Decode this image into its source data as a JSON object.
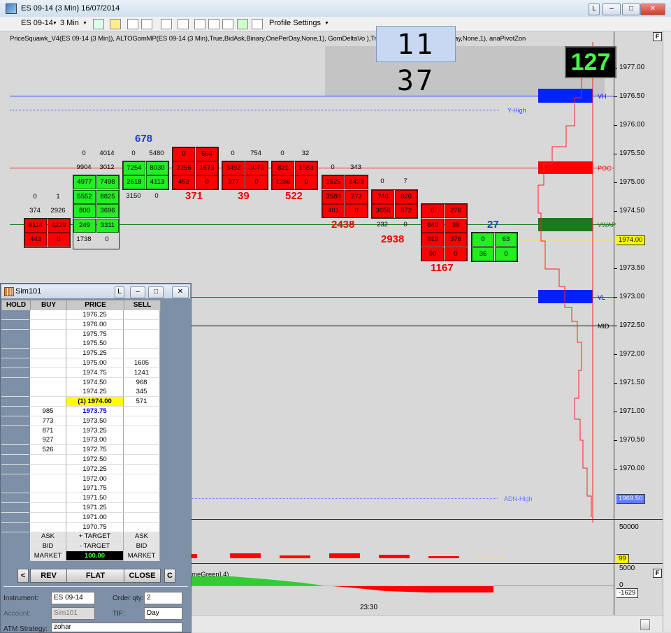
{
  "window": {
    "title": "ES 09-14 (3 Min)  16/07/2014",
    "l_btn": "L"
  },
  "toolbar": {
    "instrument": "ES 09-14",
    "interval": "3 Min",
    "profile_settings": "Profile Settings"
  },
  "indicators_text": "PriceSquawk_V4(ES 09-14 (3 Min)), ALTOGomMP(ES 09-14 (3 Min),True,BidAsk,Binary,OnePerDay,None,1), GomDeltaVo                ),True,BidAsk,Binary,OnePerDay,None,1), anaPivotZon",
  "clock": "11 37",
  "counter": "127",
  "panel_f": "F",
  "price_axis": [
    "1977.00",
    "1976.50",
    "1976.00",
    "1975.50",
    "1975.00",
    "1974.50",
    "1974.00",
    "1973.50",
    "1973.00",
    "1972.50",
    "1972.00",
    "1971.50",
    "1971.00",
    "1970.50",
    "1970.00",
    "1969.50"
  ],
  "price_tags": {
    "current": "1974.00",
    "adn": "1969.50",
    "vol": "99",
    "delta": "-1629"
  },
  "levels": {
    "vh": "VH",
    "y_high": "Y-High",
    "poc": "POC",
    "vwap": "VWAP",
    "vl": "VL",
    "mid": "MID",
    "adn_high": "ADN-High"
  },
  "volume_axis": [
    "50000",
    "5000",
    "0"
  ],
  "time_label": "23:30",
  "delta_legend": "imeGreen],4)",
  "footprint_text": [
    "0",
    "1",
    "374",
    "2926",
    "6114",
    "4229",
    "443",
    "0",
    "0",
    "4014",
    "9904",
    "3012",
    "4977",
    "7498",
    "5552",
    "8825",
    "800",
    "3696",
    "249",
    "3311",
    "1738",
    "0",
    "678",
    "0",
    "5480",
    "7254",
    "8030",
    "2618",
    "4113",
    "3150",
    "0",
    "0",
    "664",
    "2256",
    "1673",
    "452",
    "0",
    "371",
    "0",
    "754",
    "3492",
    "3076",
    "377",
    "0",
    "39",
    "0",
    "32",
    "821",
    "1583",
    "1286",
    "0",
    "522",
    "0",
    "343",
    "1525",
    "2433",
    "3580",
    "272",
    "401",
    "0",
    "2438",
    "0",
    "7",
    "746",
    "826",
    "3656",
    "872",
    "232",
    "0",
    "2938",
    "0",
    "276",
    "849",
    "39",
    "919",
    "376",
    "90",
    "0",
    "1167",
    "27",
    "0",
    "63",
    "36",
    "0"
  ],
  "sim": {
    "title": "Sim101",
    "headers": [
      "HOLD",
      "BUY",
      "PRICE",
      "SELL"
    ],
    "rows": [
      {
        "buy": "",
        "price": "1976.25",
        "sell": ""
      },
      {
        "buy": "",
        "price": "1976.00",
        "sell": ""
      },
      {
        "buy": "",
        "price": "1975.75",
        "sell": ""
      },
      {
        "buy": "",
        "price": "1975.50",
        "sell": ""
      },
      {
        "buy": "",
        "price": "1975.25",
        "sell": ""
      },
      {
        "buy": "",
        "price": "1975.00",
        "sell": "1605"
      },
      {
        "buy": "",
        "price": "1974.75",
        "sell": "1241"
      },
      {
        "buy": "",
        "price": "1974.50",
        "sell": "968"
      },
      {
        "buy": "",
        "price": "1974.25",
        "sell": "345"
      },
      {
        "buy": "",
        "price": "(1) 1974.00",
        "sell": "571"
      },
      {
        "buy": "985",
        "price": "1973.75",
        "sell": ""
      },
      {
        "buy": "773",
        "price": "1973.50",
        "sell": ""
      },
      {
        "buy": "871",
        "price": "1973.25",
        "sell": ""
      },
      {
        "buy": "927",
        "price": "1973.00",
        "sell": ""
      },
      {
        "buy": "526",
        "price": "1972.75",
        "sell": ""
      },
      {
        "buy": "",
        "price": "1972.50",
        "sell": ""
      },
      {
        "buy": "",
        "price": "1972.25",
        "sell": ""
      },
      {
        "buy": "",
        "price": "1972.00",
        "sell": ""
      },
      {
        "buy": "",
        "price": "1971.75",
        "sell": ""
      },
      {
        "buy": "",
        "price": "1971.50",
        "sell": ""
      },
      {
        "buy": "",
        "price": "1971.25",
        "sell": ""
      },
      {
        "buy": "",
        "price": "1971.00",
        "sell": ""
      },
      {
        "buy": "",
        "price": "1970.75",
        "sell": ""
      }
    ],
    "ask_row": {
      "left": "ASK",
      "mid": "+ TARGET",
      "right": "ASK"
    },
    "bid_row": {
      "left": "BID",
      "mid": "- TARGET",
      "right": "BID"
    },
    "market_row": {
      "left": "MARKET",
      "mid": "100.00",
      "right": "MARKET"
    },
    "buttons": {
      "left_arrow": "<",
      "rev": "REV",
      "flat": "FLAT",
      "close": "CLOSE",
      "c": "C"
    },
    "form": {
      "instrument_label": "Instrument:",
      "instrument": "ES 09-14",
      "order_qty_label": "Order qty:",
      "order_qty": "2",
      "account_label": "Account:",
      "account": "Sim101",
      "tif_label": "TIF:",
      "tif": "Day",
      "atm_label": "ATM Strategy:",
      "atm": "zohar"
    }
  },
  "colors": {
    "bid_cell": "#ff0000",
    "ask_cell": "#22ee22",
    "vh_vl": "#0000ff",
    "poc": "#ff0000",
    "vwap": "#1a7a1a",
    "current": "#ffff00"
  }
}
